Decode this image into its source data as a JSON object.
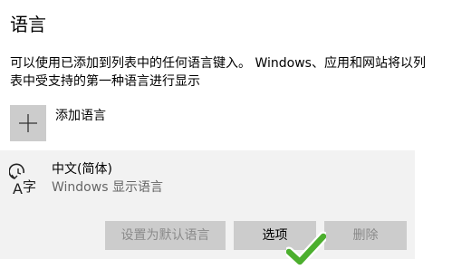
{
  "section": {
    "title": "语言",
    "description": "可以使用已添加到列表中的任何语言键入。 Windows、应用和网站将以列表中受支持的第一种语言进行显示"
  },
  "add_language": {
    "label": "添加语言",
    "icon": "plus-icon"
  },
  "language_item": {
    "name": "中文(简体)",
    "subtitle": "Windows 显示语言",
    "icon": "language-icon",
    "icon_glyph": "字",
    "icon_letter": "A",
    "buttons": {
      "set_default": "设置为默认语言",
      "options": "选项",
      "remove": "删除"
    }
  },
  "colors": {
    "button_bg": "#cccccc",
    "item_bg": "#f2f2f2",
    "disabled_text": "#8a8a8a",
    "check_green": "#4caf2e"
  }
}
